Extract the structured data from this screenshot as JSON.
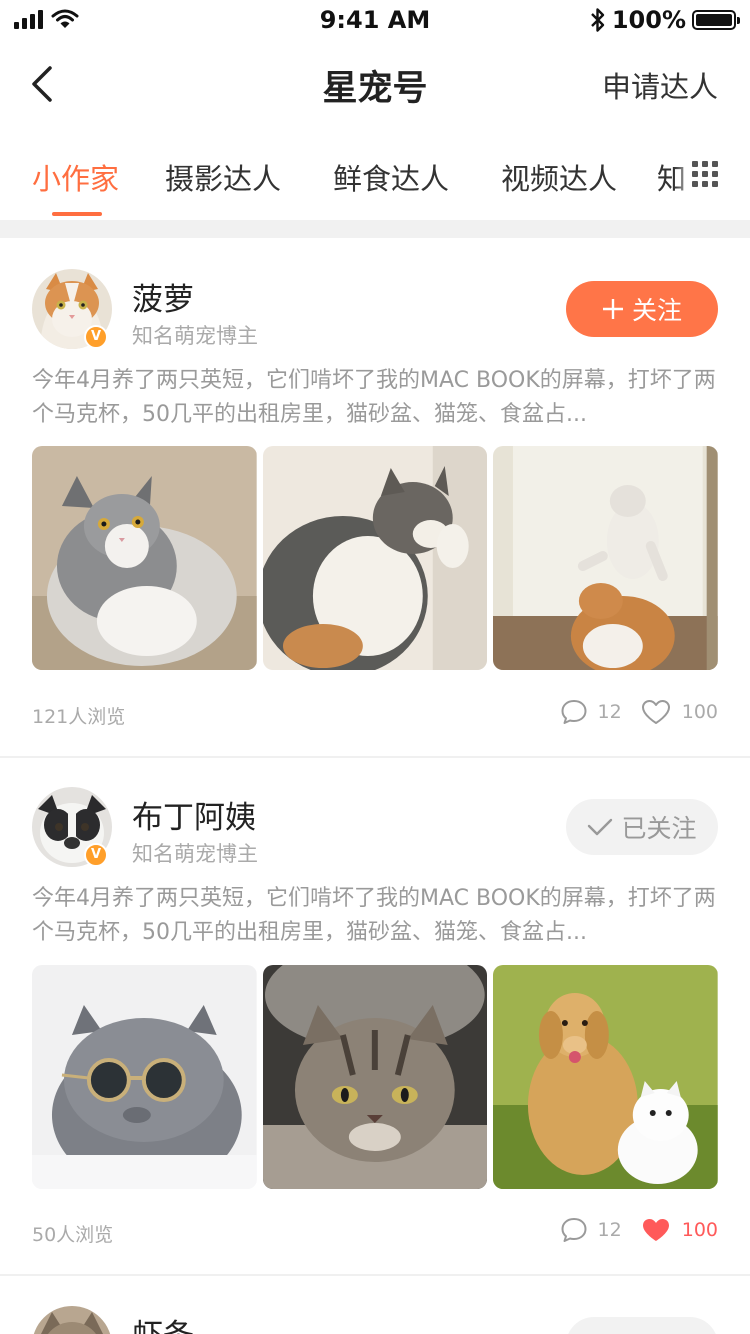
{
  "status_bar": {
    "time": "9:41 AM",
    "battery": "100%",
    "icons": [
      "signal-icon",
      "wifi-icon",
      "bluetooth-icon",
      "battery-icon"
    ]
  },
  "nav": {
    "title": "星宠号",
    "action": "申请达人",
    "back_icon": "chevron-left-icon"
  },
  "tabs": {
    "items": [
      "小作家",
      "摄影达人",
      "鲜食达人",
      "视频达人",
      "知"
    ],
    "active_index": 0,
    "more_icon": "grid-icon"
  },
  "colors": {
    "accent": "#ff6e40",
    "follow_button": "#ff7548",
    "badge": "#ff9f2a",
    "liked": "#ff5a5a",
    "muted_text": "#9a9a9a"
  },
  "posts": [
    {
      "author": "菠萝",
      "tag": "知名萌宠博主",
      "verified_badge": "V",
      "follow_label": "关注",
      "followed": false,
      "text": "今年4月养了两只英短，它们啃坏了我的MAC BOOK的屏幕，打坏了两个马克杯，50几平的出租房里，猫砂盆、猫笼、食盆占...",
      "photos": [
        "grey-white-longhair-cat",
        "calico-cat-licking-paw",
        "cats-playing-by-door"
      ],
      "views": "121人浏览",
      "comments": "12",
      "likes": "100",
      "liked": false
    },
    {
      "author": "布丁阿姨",
      "tag": "知名萌宠博主",
      "verified_badge": "V",
      "follow_label": "已关注",
      "followed": true,
      "text": "今年4月养了两只英短，它们啃坏了我的MAC BOOK的屏幕，打坏了两个马克杯，50几平的出租房里，猫砂盆、猫笼、食盆占...",
      "photos": [
        "grey-cat-with-sunglasses",
        "tabby-cat-on-carpet",
        "golden-retriever-and-white-spitz"
      ],
      "views": "50人浏览",
      "comments": "12",
      "likes": "100",
      "liked": true
    },
    {
      "author": "虾条",
      "followed": true
    }
  ]
}
